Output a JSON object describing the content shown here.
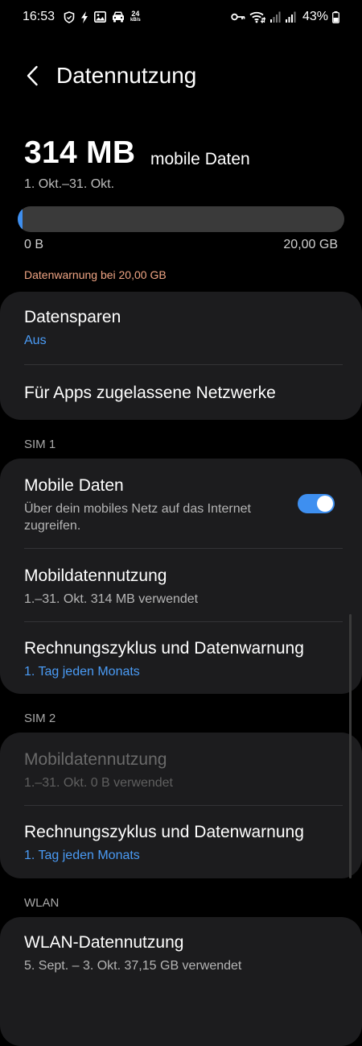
{
  "status_bar": {
    "time": "16:53",
    "speed_value": "24",
    "speed_unit": "kB/s",
    "battery": "43%",
    "icons": [
      "shield-icon",
      "bolt-icon",
      "image-icon",
      "car-icon",
      "key-icon",
      "wifi-icon",
      "signal-icon",
      "signal-icon",
      "battery-icon"
    ]
  },
  "header": {
    "title": "Datennutzung",
    "back_icon": "chevron-left-icon"
  },
  "usage": {
    "amount": "314 MB",
    "label": "mobile Daten",
    "period": "1. Okt.–31. Okt.",
    "bar_min": "0 B",
    "bar_max": "20,00 GB",
    "fill_fraction": 0.015,
    "warning": "Datenwarnung bei 20,00 GB"
  },
  "general": {
    "data_saver_title": "Datensparen",
    "data_saver_value": "Aus",
    "allowed_networks_title": "Für Apps zugelassene Netzwerke"
  },
  "sim1": {
    "section": "SIM 1",
    "mobile_data_title": "Mobile Daten",
    "mobile_data_desc": "Über dein mobiles Netz auf das Internet zugreifen.",
    "mobile_data_enabled": true,
    "usage_title": "Mobildatennutzung",
    "usage_value": "1.–31. Okt. 314 MB verwendet",
    "billing_title": "Rechnungszyklus und Datenwarnung",
    "billing_value": "1. Tag jeden Monats"
  },
  "sim2": {
    "section": "SIM 2",
    "usage_title": "Mobildatennutzung",
    "usage_value": "1.–31. Okt. 0 B verwendet",
    "billing_title": "Rechnungszyklus und Datenwarnung",
    "billing_value": "1. Tag jeden Monats"
  },
  "wlan": {
    "section": "WLAN",
    "usage_title": "WLAN-Datennutzung",
    "usage_value": "5. Sept. – 3. Okt. 37,15 GB verwendet"
  },
  "colors": {
    "accent": "#3e8ff0",
    "warning": "#f0a584",
    "card": "#1c1c1e",
    "background": "#000000"
  }
}
